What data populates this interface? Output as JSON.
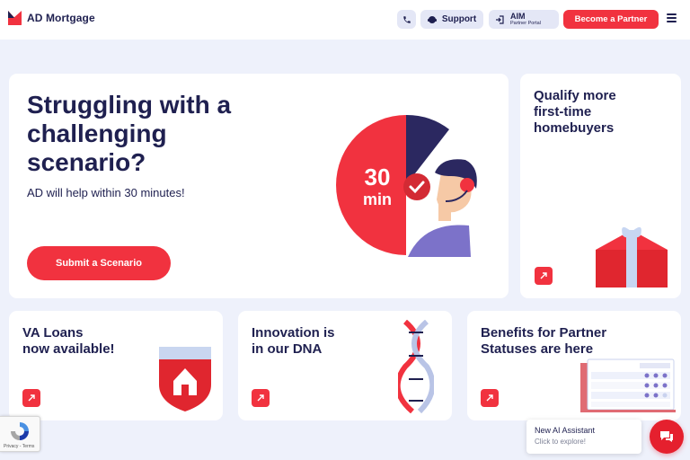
{
  "header": {
    "logo_text": "AD Mortgage",
    "support_label": "Support",
    "aim_title": "AIM",
    "aim_subtitle": "Partner Portal",
    "partner_label": "Become a Partner"
  },
  "hero": {
    "title": "Struggling with a challenging scenario?",
    "subtitle": "AD will help within 30 minutes!",
    "cta_label": "Submit a Scenario",
    "timer_number": "30",
    "timer_unit": "min"
  },
  "cards": {
    "qualify": {
      "title": "Qualify more\nfirst-time\nhomebuyers"
    },
    "va": {
      "title": "VA Loans\nnow available!"
    },
    "dna": {
      "title": "Innovation is\nin our DNA"
    },
    "benefits": {
      "title": "Benefits for Partner\nStatuses are here"
    }
  },
  "recaptcha": {
    "links": "Privacy - Terms"
  },
  "assistant": {
    "title": "New AI Assistant",
    "subtitle": "Click to explore!"
  },
  "colors": {
    "brand_red": "#f1323f",
    "navy": "#1f2050",
    "background": "#eef1fb"
  },
  "icons": [
    "logo-icon",
    "phone-icon",
    "support-icon",
    "login-icon",
    "menu-icon",
    "arrow-up-right-icon",
    "chat-icon",
    "recaptcha-icon"
  ]
}
